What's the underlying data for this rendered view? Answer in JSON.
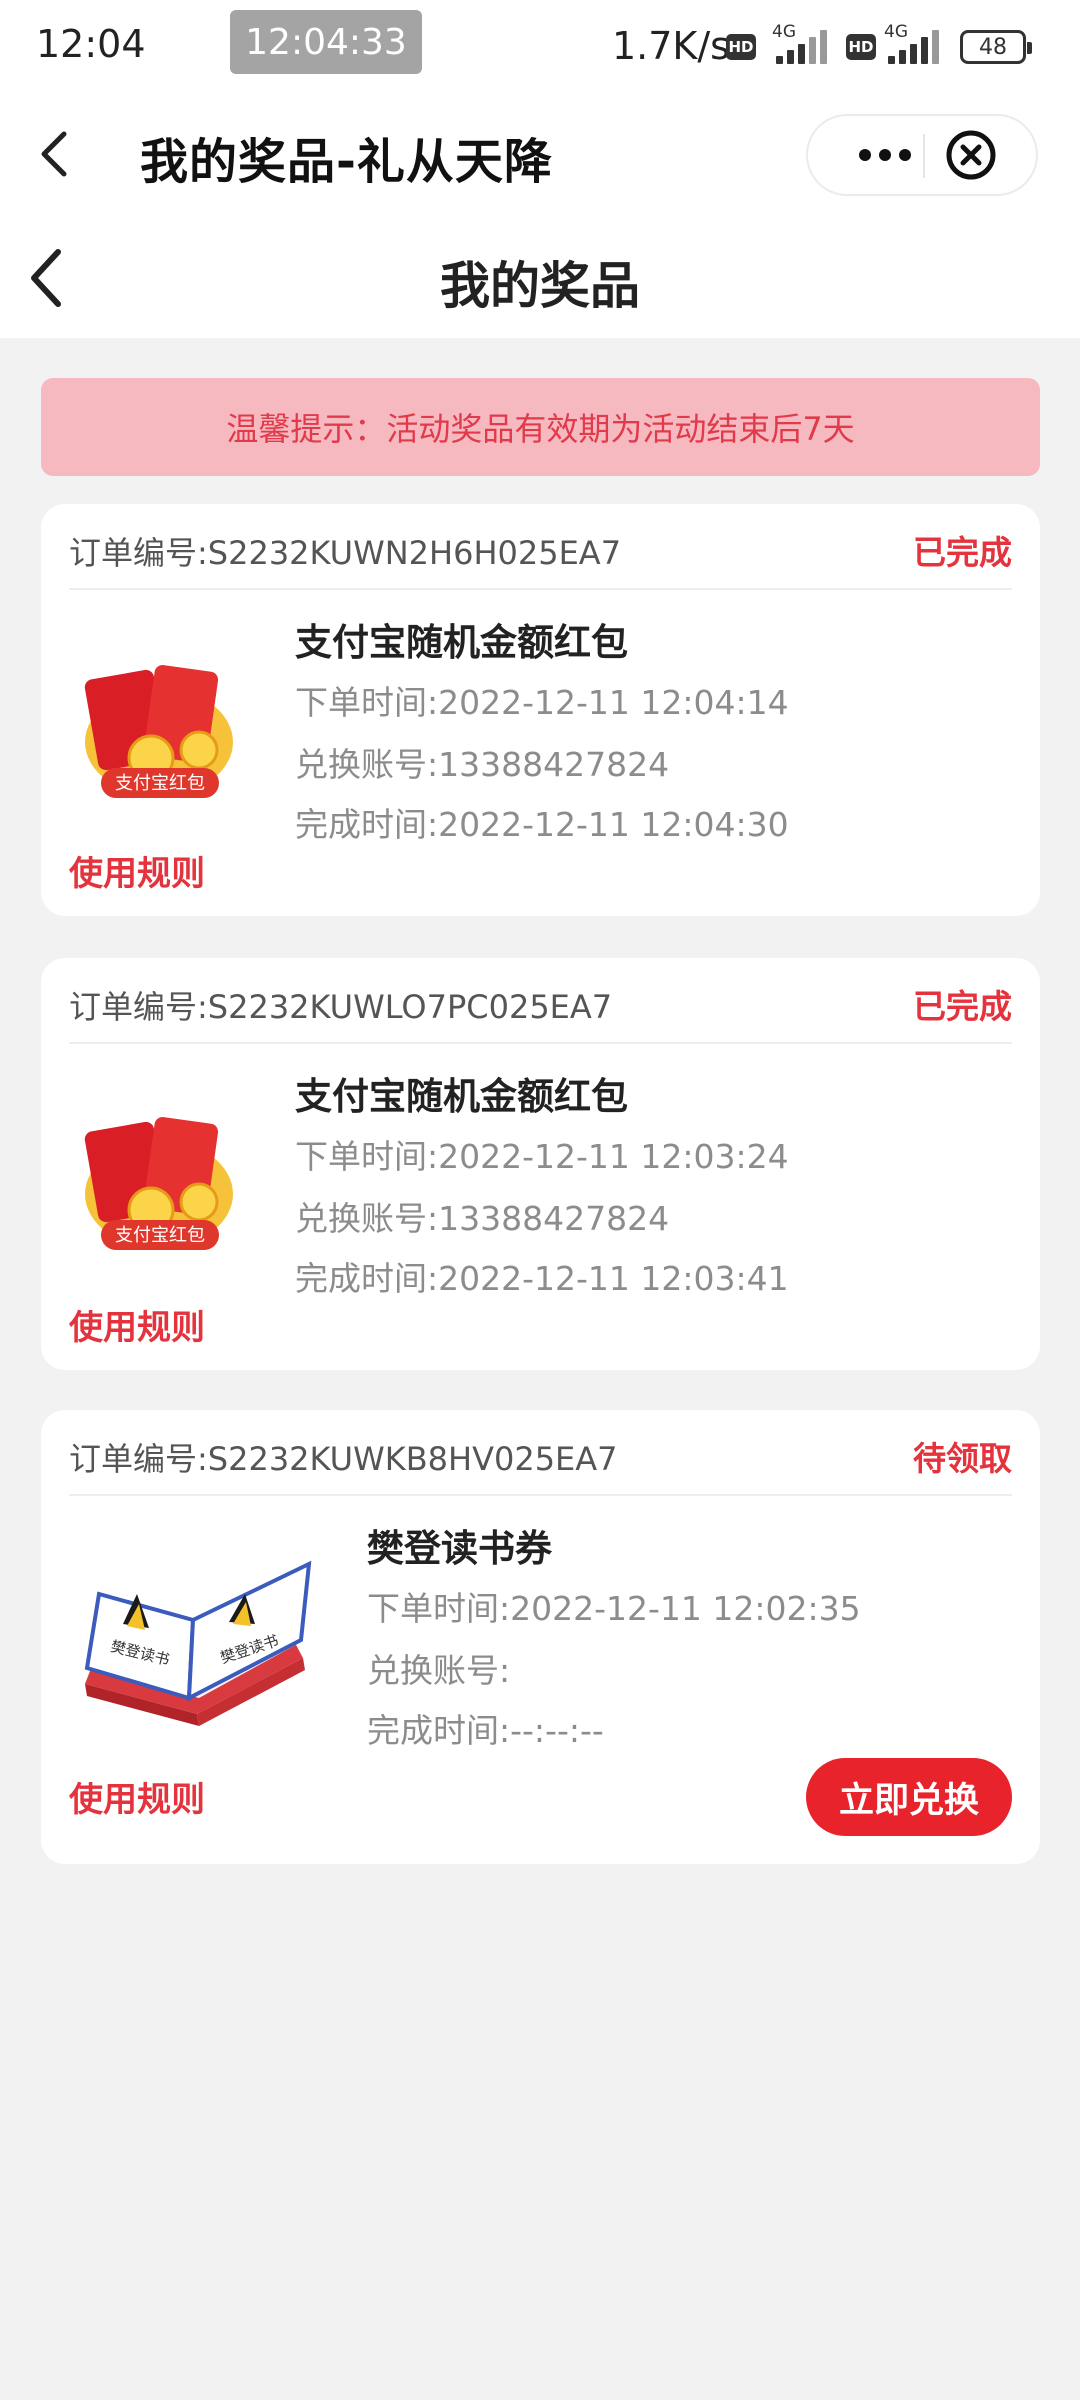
{
  "status_bar": {
    "time": "12:04",
    "recording_time": "12:04:33",
    "net_speed": "1.7K/s",
    "hd_label": "HD",
    "net_type": "4G",
    "battery": "48"
  },
  "miniprogram": {
    "title": "我的奖品-礼从天降"
  },
  "page": {
    "title": "我的奖品"
  },
  "notice": "温馨提示：活动奖品有效期为活动结束后7天",
  "colors": {
    "accent": "#e4333c",
    "notice_bg": "#f6b9c0",
    "page_bg": "#f2f2f2"
  },
  "orders": [
    {
      "order_no": "订单编号:S2232KUWN2H6H025EA7",
      "status": "已完成",
      "name": "支付宝随机金额红包",
      "order_time": "下单时间:2022-12-11 12:04:14",
      "account": "兑换账号:13388427824",
      "complete_time": "完成时间:2022-12-11 12:04:30",
      "rule": "使用规则",
      "image_label": "支付宝红包",
      "icon": "red-envelope-icon"
    },
    {
      "order_no": "订单编号:S2232KUWLO7PC025EA7",
      "status": "已完成",
      "name": "支付宝随机金额红包",
      "order_time": "下单时间:2022-12-11 12:03:24",
      "account": "兑换账号:13388427824",
      "complete_time": "完成时间:2022-12-11 12:03:41",
      "rule": "使用规则",
      "image_label": "支付宝红包",
      "icon": "red-envelope-icon"
    },
    {
      "order_no": "订单编号:S2232KUWKB8HV025EA7",
      "status": "待领取",
      "name": "樊登读书券",
      "order_time": "下单时间:2022-12-11 12:02:35",
      "account": "兑换账号:",
      "complete_time": "完成时间:--:--:--",
      "rule": "使用规则",
      "action": "立即兑换",
      "image_label": "樊登读书",
      "icon": "book-icon"
    }
  ]
}
